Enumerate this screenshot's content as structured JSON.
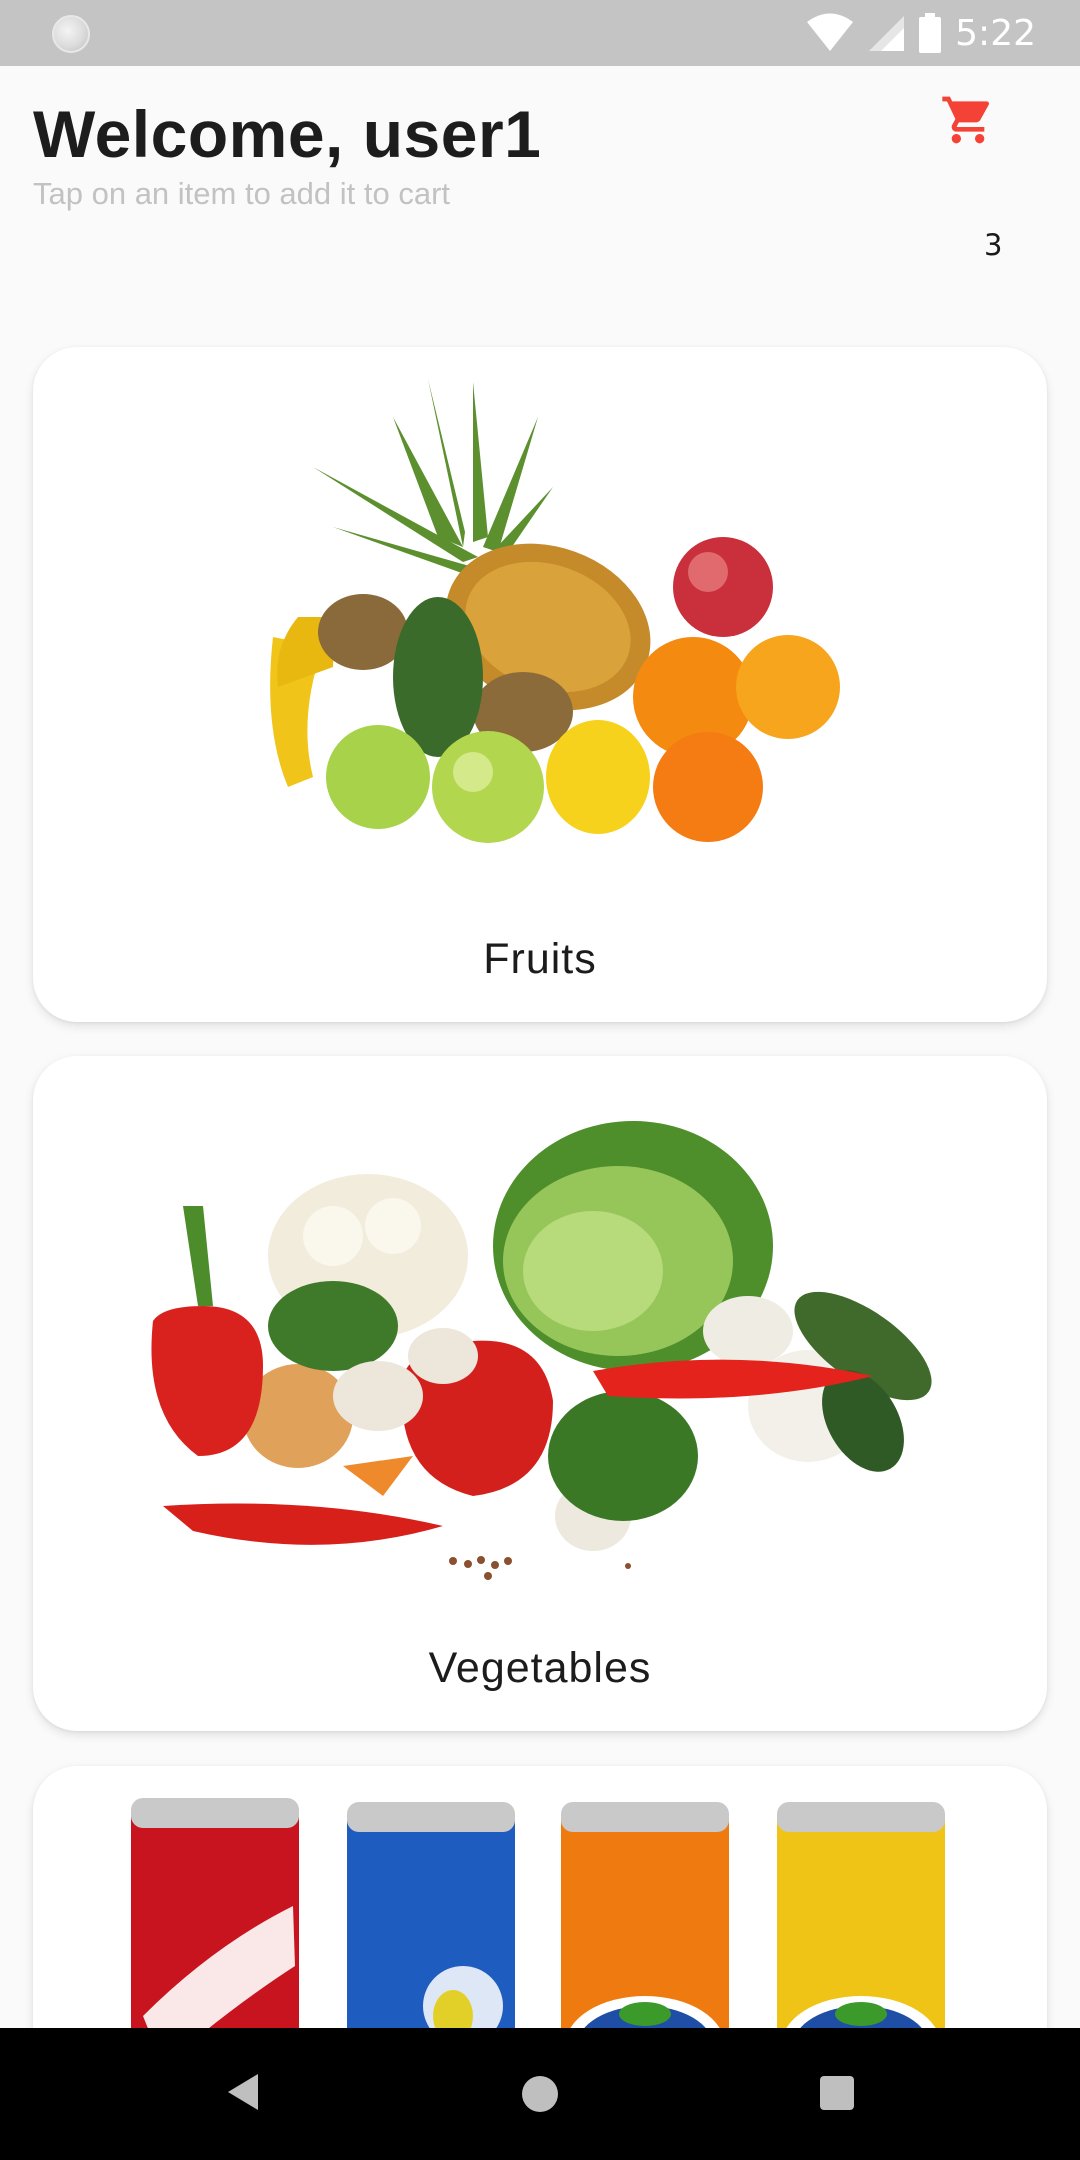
{
  "status_bar": {
    "time": "5:22"
  },
  "header": {
    "welcome": "Welcome, user1",
    "subtitle": "Tap on an item to add it to cart",
    "cart_count": "3"
  },
  "categories": [
    {
      "label": "Fruits",
      "image": "fruits-photo"
    },
    {
      "label": "Vegetables",
      "image": "vegetables-photo"
    },
    {
      "label": "",
      "image": "drinks-photo"
    }
  ],
  "colors": {
    "accent": "#f44336",
    "background": "#fafafa",
    "status_bar": "#c4c4c4"
  },
  "icons": [
    "status-dot-icon",
    "wifi-icon",
    "signal-icon",
    "battery-icon",
    "cart-icon",
    "back-icon",
    "home-icon",
    "recents-icon"
  ]
}
